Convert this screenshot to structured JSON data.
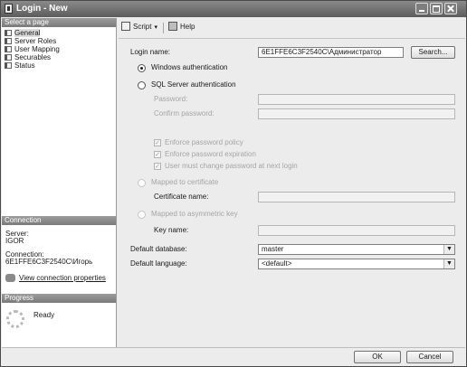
{
  "window": {
    "title": "Login - New"
  },
  "left_pane": {
    "select_page_header": "Select a page",
    "pages": [
      {
        "label": "General",
        "selected": true
      },
      {
        "label": "Server Roles"
      },
      {
        "label": "User Mapping"
      },
      {
        "label": "Securables"
      },
      {
        "label": "Status"
      }
    ],
    "connection_header": "Connection",
    "server_label": "Server:",
    "server_value": "IGOR",
    "connection_label": "Connection:",
    "connection_value": "6E1FFE6C3F2540C\\Игорь",
    "view_connection_properties": "View connection properties",
    "progress_header": "Progress",
    "progress_status": "Ready"
  },
  "toolbar": {
    "script_label": "Script",
    "help_label": "Help"
  },
  "form": {
    "login_name_label": "Login name:",
    "login_name_value": "6E1FFE6C3F2540C\\Администратор",
    "search_button": "Search...",
    "windows_auth_label": "Windows authentication",
    "sql_auth_label": "SQL Server authentication",
    "password_label": "Password:",
    "confirm_password_label": "Confirm password:",
    "enforce_policy_label": "Enforce password policy",
    "enforce_expiration_label": "Enforce password expiration",
    "must_change_label": "User must change password at next login",
    "mapped_certificate_label": "Mapped to certificate",
    "certificate_name_label": "Certificate name:",
    "mapped_asym_key_label": "Mapped to asymmetric key",
    "key_name_label": "Key name:",
    "default_database_label": "Default database:",
    "default_database_value": "master",
    "default_language_label": "Default language:",
    "default_language_value": "<default>"
  },
  "footer": {
    "ok_button": "OK",
    "cancel_button": "Cancel"
  }
}
